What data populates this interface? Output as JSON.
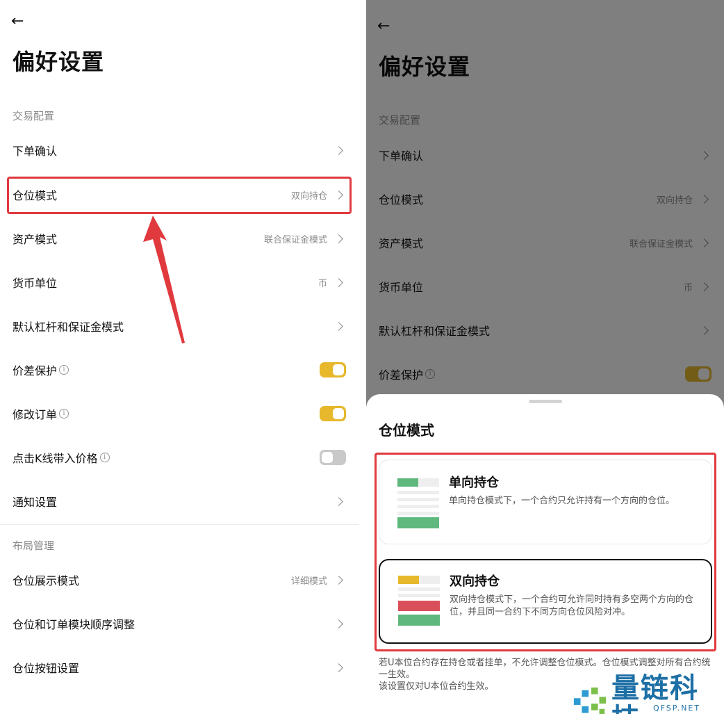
{
  "left": {
    "back_icon": "arrow-left-icon",
    "title": "偏好设置",
    "sections": [
      {
        "label": "交易配置"
      },
      {
        "label": "布局管理"
      }
    ],
    "rows": {
      "order_confirm": {
        "label": "下单确认"
      },
      "position_mode": {
        "label": "仓位模式",
        "value": "双向持仓"
      },
      "asset_mode": {
        "label": "资产模式",
        "value": "联合保证金模式"
      },
      "currency_unit": {
        "label": "货币单位",
        "value": "币"
      },
      "default_leverage": {
        "label": "默认杠杆和保证金模式"
      },
      "price_protection": {
        "label": "价差保护",
        "enabled": true
      },
      "modify_order": {
        "label": "修改订单",
        "enabled": true
      },
      "kline_price": {
        "label": "点击K线带入价格",
        "enabled": false
      },
      "notification": {
        "label": "通知设置"
      },
      "position_display": {
        "label": "仓位展示模式",
        "value": "详细模式"
      },
      "module_order": {
        "label": "仓位和订单模块顺序调整"
      },
      "position_buttons": {
        "label": "仓位按钮设置"
      }
    },
    "info_glyph": "i"
  },
  "right": {
    "title": "偏好设置",
    "section": "交易配置",
    "rows": {
      "order_confirm": {
        "label": "下单确认"
      },
      "position_mode": {
        "label": "仓位模式",
        "value": "双向持仓"
      },
      "asset_mode": {
        "label": "资产模式",
        "value": "联合保证金模式"
      },
      "currency_unit": {
        "label": "货币单位",
        "value": "币"
      },
      "default_leverage": {
        "label": "默认杠杆和保证金模式"
      },
      "price_protection": {
        "label": "价差保护",
        "enabled": true
      }
    },
    "sheet": {
      "title": "仓位模式",
      "options": [
        {
          "title": "单向持仓",
          "desc": "单向持仓模式下，一个合约只允许持有一个方向的仓位。",
          "selected": false
        },
        {
          "title": "双向持仓",
          "desc": "双向持仓模式下，一个合约可允许同时持有多空两个方向的仓位，并且同一合约下不同方向仓位风险对冲。",
          "selected": true
        }
      ],
      "note_1": "若U本位合约存在持仓或者挂单，不允许调整仓位模式。仓位模式调整对所有合约统一生效。",
      "note_2": "该设置仅对U本位合约生效。"
    }
  },
  "colors": {
    "accent": "#e7b82c",
    "highlight": "#e0393e",
    "green": "#5fb87d",
    "red": "#d9505a"
  },
  "watermark": {
    "text": "量链科技",
    "sub": "QFSP.NET"
  }
}
